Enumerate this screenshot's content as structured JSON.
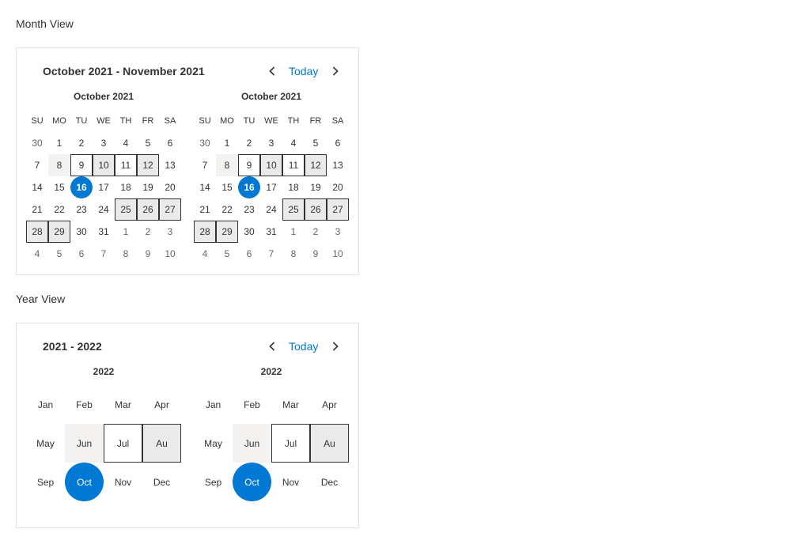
{
  "month_view": {
    "section_title": "Month View",
    "header": "October 2021 - November 2021",
    "today_label": "Today",
    "calendars": [
      {
        "title": "October 2021",
        "weekdays": [
          "SU",
          "MO",
          "TU",
          "WE",
          "TH",
          "FR",
          "SA"
        ],
        "days": [
          [
            "30",
            "other"
          ],
          [
            "1",
            ""
          ],
          [
            "2",
            ""
          ],
          [
            "3",
            ""
          ],
          [
            "4",
            ""
          ],
          [
            "5",
            ""
          ],
          [
            "6",
            ""
          ],
          [
            "7",
            ""
          ],
          [
            "8",
            "hover"
          ],
          [
            "9",
            "outline"
          ],
          [
            "10",
            "sel"
          ],
          [
            "11",
            "outline"
          ],
          [
            "12",
            "sel"
          ],
          [
            "13",
            ""
          ],
          [
            "14",
            ""
          ],
          [
            "15",
            ""
          ],
          [
            "16",
            "today"
          ],
          [
            "17",
            ""
          ],
          [
            "18",
            ""
          ],
          [
            "19",
            ""
          ],
          [
            "20",
            ""
          ],
          [
            "21",
            ""
          ],
          [
            "22",
            ""
          ],
          [
            "23",
            ""
          ],
          [
            "24",
            ""
          ],
          [
            "25",
            "sel"
          ],
          [
            "26",
            "sel"
          ],
          [
            "27",
            "sel"
          ],
          [
            "28",
            "sel"
          ],
          [
            "29",
            "sel"
          ],
          [
            "30",
            ""
          ],
          [
            "31",
            ""
          ],
          [
            "1",
            "other"
          ],
          [
            "2",
            "other"
          ],
          [
            "3",
            "other"
          ],
          [
            "4",
            "other"
          ],
          [
            "5",
            "other"
          ],
          [
            "6",
            "other"
          ],
          [
            "7",
            "other"
          ],
          [
            "8",
            "other"
          ],
          [
            "9",
            "other"
          ],
          [
            "10",
            "other"
          ]
        ]
      },
      {
        "title": "October 2021",
        "weekdays": [
          "SU",
          "MO",
          "TU",
          "WE",
          "TH",
          "FR",
          "SA"
        ],
        "days": [
          [
            "30",
            "other"
          ],
          [
            "1",
            ""
          ],
          [
            "2",
            ""
          ],
          [
            "3",
            ""
          ],
          [
            "4",
            ""
          ],
          [
            "5",
            ""
          ],
          [
            "6",
            ""
          ],
          [
            "7",
            ""
          ],
          [
            "8",
            "hover"
          ],
          [
            "9",
            "outline"
          ],
          [
            "10",
            "sel"
          ],
          [
            "11",
            "outline"
          ],
          [
            "12",
            "sel"
          ],
          [
            "13",
            ""
          ],
          [
            "14",
            ""
          ],
          [
            "15",
            ""
          ],
          [
            "16",
            "today"
          ],
          [
            "17",
            ""
          ],
          [
            "18",
            ""
          ],
          [
            "19",
            ""
          ],
          [
            "20",
            ""
          ],
          [
            "21",
            ""
          ],
          [
            "22",
            ""
          ],
          [
            "23",
            ""
          ],
          [
            "24",
            ""
          ],
          [
            "25",
            "sel"
          ],
          [
            "26",
            "sel"
          ],
          [
            "27",
            "sel"
          ],
          [
            "28",
            "sel"
          ],
          [
            "29",
            "sel"
          ],
          [
            "30",
            ""
          ],
          [
            "31",
            ""
          ],
          [
            "1",
            "other"
          ],
          [
            "2",
            "other"
          ],
          [
            "3",
            "other"
          ],
          [
            "4",
            "other"
          ],
          [
            "5",
            "other"
          ],
          [
            "6",
            "other"
          ],
          [
            "7",
            "other"
          ],
          [
            "8",
            "other"
          ],
          [
            "9",
            "other"
          ],
          [
            "10",
            "other"
          ]
        ]
      }
    ]
  },
  "year_view": {
    "section_title": "Year View",
    "header": "2021 - 2022",
    "today_label": "Today",
    "calendars": [
      {
        "title": "2022",
        "months": [
          [
            "Jan",
            ""
          ],
          [
            "Feb",
            ""
          ],
          [
            "Mar",
            ""
          ],
          [
            "Apr",
            ""
          ],
          [
            "May",
            ""
          ],
          [
            "Jun",
            "hover"
          ],
          [
            "Jul",
            "outline"
          ],
          [
            "Au",
            "sel"
          ],
          [
            "Sep",
            ""
          ],
          [
            "Oct",
            "today"
          ],
          [
            "Nov",
            ""
          ],
          [
            "Dec",
            ""
          ]
        ]
      },
      {
        "title": "2022",
        "months": [
          [
            "Jan",
            ""
          ],
          [
            "Feb",
            ""
          ],
          [
            "Mar",
            ""
          ],
          [
            "Apr",
            ""
          ],
          [
            "May",
            ""
          ],
          [
            "Jun",
            "hover"
          ],
          [
            "Jul",
            "outline"
          ],
          [
            "Au",
            "sel"
          ],
          [
            "Sep",
            ""
          ],
          [
            "Oct",
            "today"
          ],
          [
            "Nov",
            ""
          ],
          [
            "Dec",
            ""
          ]
        ]
      }
    ]
  },
  "icons": {
    "prev": "chevron-left-icon",
    "next": "chevron-right-icon"
  },
  "colors": {
    "accent": "#0078d4",
    "selected_bg": "#eaeaea",
    "hover_bg": "#f3f2f1"
  }
}
